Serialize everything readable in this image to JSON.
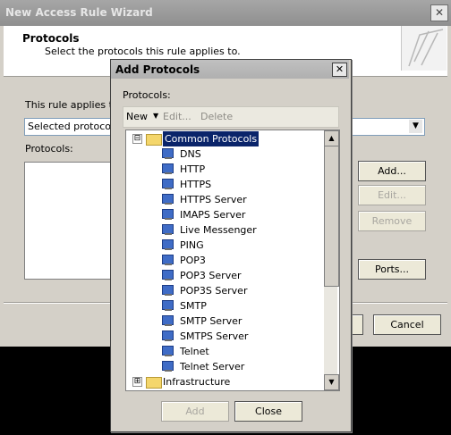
{
  "wizard": {
    "title": "New Access Rule Wizard",
    "close_glyph": "✕",
    "header_title": "Protocols",
    "header_subtitle": "Select the protocols this rule applies to.",
    "applies_label": "This rule applies to:",
    "applies_value": "Selected protocols",
    "protocols_label": "Protocols:",
    "buttons": {
      "add": "Add...",
      "edit": "Edit...",
      "remove": "Remove",
      "ports": "Ports...",
      "cancel": "Cancel"
    }
  },
  "dialog": {
    "title": "Add Protocols",
    "close_glyph": "✕",
    "protocols_label": "Protocols:",
    "toolbar": {
      "new": "New",
      "new_arrow": "▼",
      "edit": "Edit...",
      "delete": "Delete"
    },
    "tree": {
      "group_expander": "⊟",
      "group_label": "Common Protocols",
      "items": [
        "DNS",
        "HTTP",
        "HTTPS",
        "HTTPS Server",
        "IMAPS Server",
        "Live Messenger",
        "PING",
        "POP3",
        "POP3 Server",
        "POP3S Server",
        "SMTP",
        "SMTP Server",
        "SMTPS Server",
        "Telnet",
        "Telnet Server"
      ],
      "second_group_expander": "⊞",
      "second_group_label": "Infrastructure"
    },
    "buttons": {
      "add": "Add",
      "close": "Close"
    }
  },
  "icons": {
    "folder": "folder-icon",
    "protocol": "protocol-icon"
  }
}
